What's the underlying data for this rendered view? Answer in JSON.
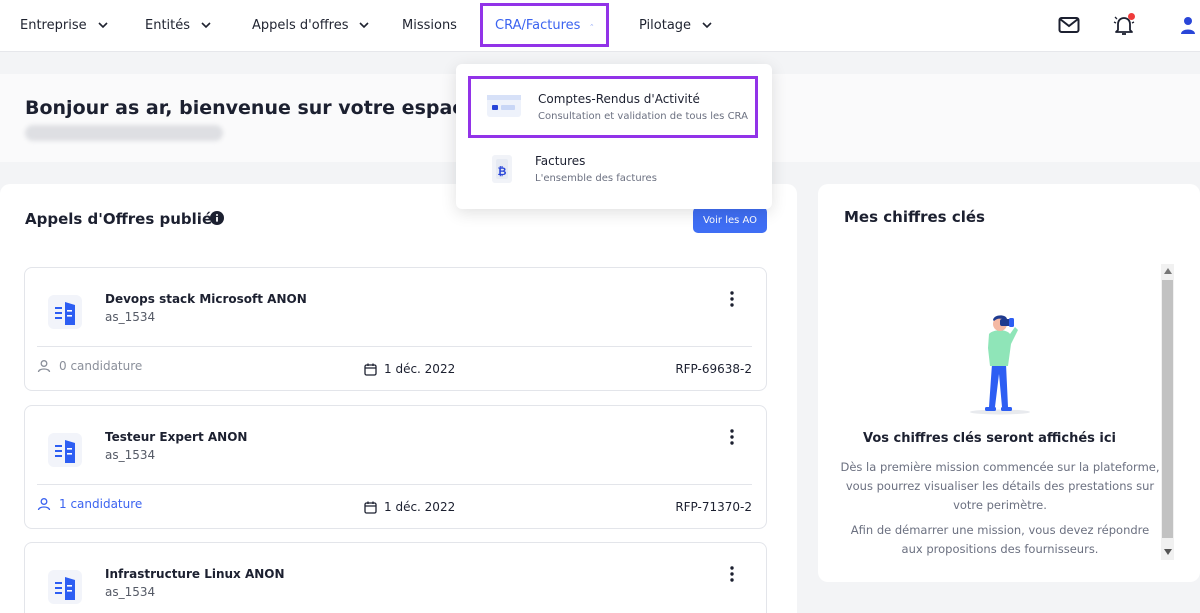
{
  "nav": {
    "items": [
      {
        "label": "Entreprise",
        "has_chevron": true
      },
      {
        "label": "Entités",
        "has_chevron": true
      },
      {
        "label": "Appels d'offres",
        "has_chevron": true
      },
      {
        "label": "Missions",
        "has_chevron": false
      },
      {
        "label": "CRA/Factures",
        "has_chevron": true,
        "active": true
      },
      {
        "label": "Pilotage",
        "has_chevron": true
      }
    ],
    "icons": [
      "mail-icon",
      "bell-icon",
      "user-icon"
    ],
    "notification_dot": true
  },
  "welcome": {
    "title": "Bonjour as ar, bienvenue sur votre espace Lit"
  },
  "dropdown": {
    "items": [
      {
        "title": "Comptes-Rendus d'Activité",
        "subtitle": "Consultation et validation de tous les CRA",
        "highlighted": true
      },
      {
        "title": "Factures",
        "subtitle": "L'ensemble des factures",
        "highlighted": false
      }
    ]
  },
  "ao_section": {
    "title": "Appels d'Offres publiés",
    "button_label": "Voir les AO",
    "items": [
      {
        "title": "Devops stack Microsoft ANON",
        "subtitle": "as_1534",
        "candidatures": "0 candidature",
        "date": "1 déc. 2022",
        "ref": "RFP-69638-2"
      },
      {
        "title": "Testeur Expert ANON",
        "subtitle": "as_1534",
        "candidatures": "1 candidature",
        "date": "1 déc. 2022",
        "ref": "RFP-71370-2"
      },
      {
        "title": "Infrastructure Linux ANON",
        "subtitle": "as_1534"
      }
    ]
  },
  "kpi_section": {
    "title": "Mes chiffres clés",
    "empty_heading": "Vos chiffres clés seront affichés ici",
    "empty_text_1": "Dès la première mission commencée sur la plateforme, vous pourrez visualiser les détails des prestations sur votre perimètre.",
    "empty_text_2": "Afin de démarrer une mission, vous devez répondre aux propositions des fournisseurs."
  },
  "colors": {
    "accent": "#3b63f0",
    "highlight_border": "#9233e8",
    "primary_button": "#3f6ef4",
    "notification": "#ef3b3b"
  }
}
